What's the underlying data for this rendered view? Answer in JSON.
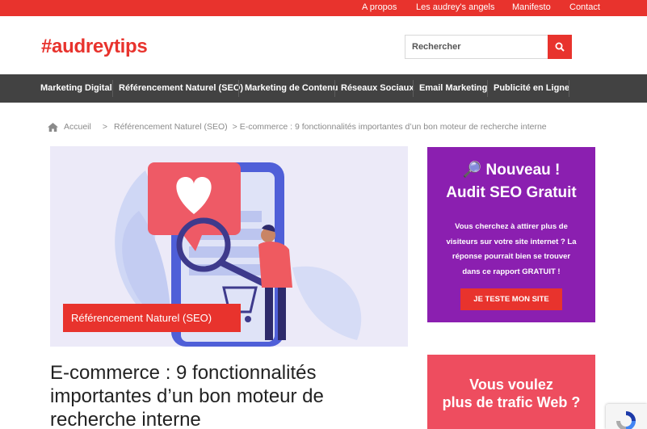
{
  "topbar": {
    "links": [
      "A propos",
      "Les audrey's angels",
      "Manifesto",
      "Contact"
    ]
  },
  "header": {
    "logo": "#audreytips",
    "search_placeholder": "Rechercher"
  },
  "nav": {
    "items": [
      "Marketing Digital",
      "Référencement Naturel (SEO)",
      "Marketing de Contenu",
      "Réseaux Sociaux",
      "Email Marketing",
      "Publicité en Ligne"
    ]
  },
  "breadcrumb": {
    "home": "Accueil",
    "sep": ">",
    "category": "Référencement Naturel (SEO)",
    "current": "> E-commerce : 9 fonctionnalités importantes d’un bon moteur de recherche interne"
  },
  "article": {
    "category_badge": "Référencement Naturel (SEO)",
    "title": "E-commerce : 9 fonctionnalités importantes d’un bon moteur de recherche interne"
  },
  "sidebar": {
    "promo1": {
      "heading1": "🔎 Nouveau !",
      "heading2": "Audit SEO Gratuit",
      "text": "Vous cherchez à attirer plus de visiteurs sur votre site internet ? La réponse pourrait bien se trouver dans ce rapport GRATUIT !",
      "button": "JE TESTE MON SITE"
    },
    "promo2": {
      "line1": "Vous voulez",
      "line2": "plus de trafic Web ?"
    }
  },
  "colors": {
    "brand_red": "#e8332d",
    "nav_bg": "#424242",
    "promo_purple": "#8b1fb0",
    "promo_pink": "#ee4d5f"
  },
  "icons": [
    "search-icon",
    "home-icon",
    "magnifier-icon",
    "heart-icon",
    "recaptcha-icon"
  ]
}
